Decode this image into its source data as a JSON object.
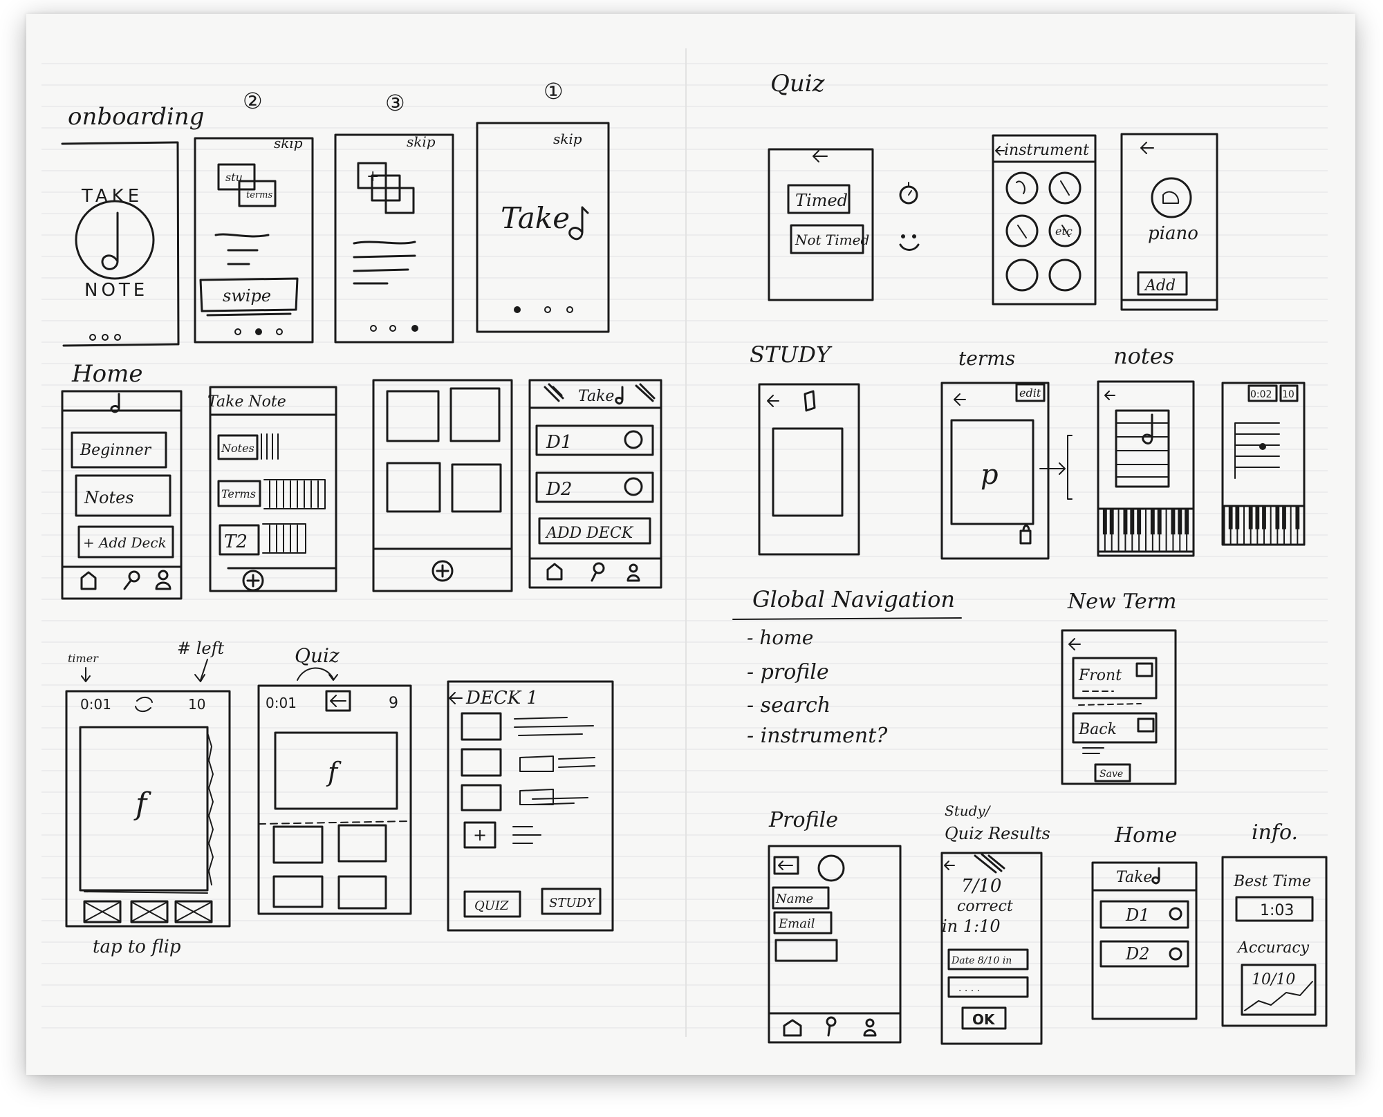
{
  "left_page": {
    "onboarding": {
      "heading": "onboarding",
      "step_numbers": [
        "②",
        "③",
        "①"
      ],
      "screen1": {
        "top_word": "TAKE",
        "bottom_word": "NOTE"
      },
      "screen2": {
        "skip": "skip",
        "card1": "stu",
        "card2": "terms",
        "swipe": "swipe"
      },
      "screen3": {
        "skip": "skip",
        "plus": "+"
      },
      "screen4": {
        "skip": "skip",
        "title": "Take"
      }
    },
    "home": {
      "heading": "Home",
      "screen1": {
        "buttons": [
          "Beginner",
          "Notes",
          "+ Add Deck"
        ]
      },
      "screen2": {
        "title": "Take Note",
        "rows": [
          "Notes",
          "Terms",
          "T2"
        ]
      },
      "screen4": {
        "title": "Take",
        "decks": [
          "D1",
          "D2"
        ],
        "add": "ADD DECK"
      }
    },
    "quiz_flow": {
      "annotations": {
        "timer": "timer",
        "left": "# left",
        "quiz": "Quiz",
        "tap": "tap to flip"
      },
      "screen1": {
        "time": "0:01",
        "count": "10",
        "card": "f"
      },
      "screen2": {
        "time": "0:01",
        "count": "9",
        "card": "f"
      },
      "screen3": {
        "title": "DECK 1",
        "quiz_btn": "QUIZ",
        "study_btn": "STUDY",
        "plus": "+"
      }
    }
  },
  "right_page": {
    "quiz": {
      "heading": "Quiz",
      "screen1": {
        "timed": "Timed",
        "not_timed": "Not Timed"
      },
      "screen2": {
        "title": "instrument",
        "circle_label": "etc"
      },
      "screen3": {
        "label": "piano",
        "add": "Add"
      }
    },
    "study": {
      "headings": {
        "study": "STUDY",
        "terms": "terms",
        "notes": "notes"
      },
      "terms_screen": {
        "edit": "edit",
        "symbol": "p"
      },
      "notes_screen2": {
        "time": "0:02",
        "count": "10"
      }
    },
    "global_nav": {
      "heading": "Global Navigation",
      "items": [
        "- home",
        "- profile",
        "- search",
        "- instrument?"
      ]
    },
    "new_term": {
      "heading": "New Term",
      "front": "Front",
      "back": "Back",
      "save": "Save"
    },
    "bottom": {
      "profile": {
        "heading": "Profile",
        "name": "Name",
        "email": "Email"
      },
      "results": {
        "heading_line1": "Study/",
        "heading_line2": "Quiz Results",
        "score": "7/10",
        "correct": "correct",
        "time": "in 1:10",
        "date": "Date 8/10 in",
        "dots": ". . . .",
        "ok": "OK"
      },
      "home": {
        "heading": "Home",
        "title": "Take",
        "decks": [
          "D1",
          "D2"
        ]
      },
      "info": {
        "heading": "info.",
        "best_time": "Best Time",
        "time_value": "1:03",
        "accuracy": "Accuracy",
        "accuracy_value": "10/10"
      }
    }
  }
}
